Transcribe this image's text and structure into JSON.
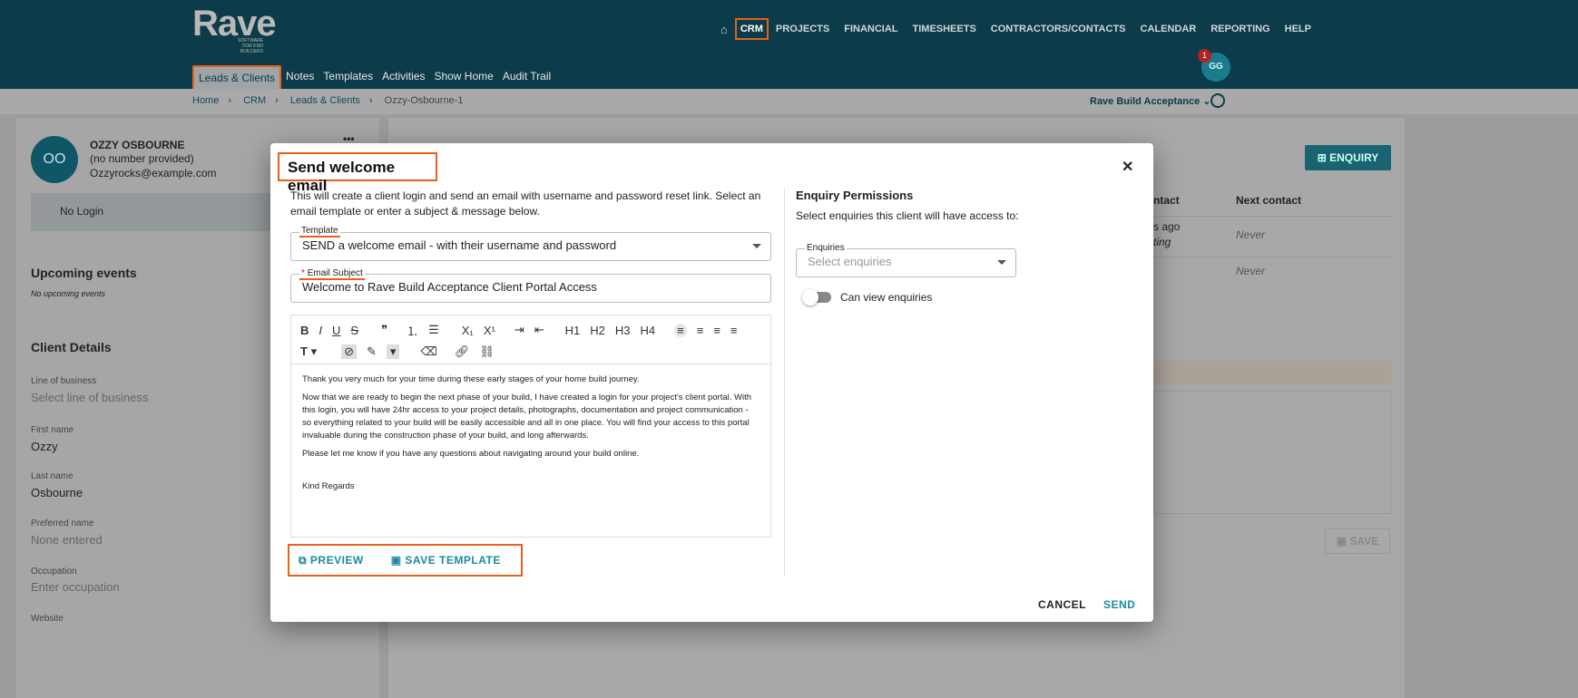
{
  "header": {
    "logo": "Rave",
    "logo_sub": "SOFTWARE FOR KIWI BUILDERS",
    "nav": [
      "CRM",
      "PROJECTS",
      "FINANCIAL",
      "TIMESHEETS",
      "CONTRACTORS/CONTACTS",
      "CALENDAR",
      "REPORTING",
      "HELP"
    ],
    "subnav": [
      "Leads & Clients",
      "Notes",
      "Templates",
      "Activities",
      "Show Home",
      "Audit Trail"
    ],
    "avatar": "GG",
    "notifications": "1"
  },
  "breadcrumb": [
    "Home",
    "CRM",
    "Leads & Clients",
    "Ozzy-Osbourne-1"
  ],
  "project_selector": "Rave Build Acceptance",
  "client": {
    "initials": "OO",
    "name": "OZZY OSBOURNE",
    "phone": "(no number provided)",
    "email": "Ozzyrocks@example.com",
    "login": "No Login",
    "upcoming_title": "Upcoming events",
    "upcoming_empty": "No upcoming events",
    "details_title": "Client Details",
    "fields": [
      {
        "label": "Line of business",
        "value": "Select line of business"
      },
      {
        "label": "First name",
        "value": "Ozzy"
      },
      {
        "label": "Last name",
        "value": "Osbourne"
      },
      {
        "label": "Preferred name",
        "value": "None entered"
      },
      {
        "label": "Occupation",
        "value": "Enter occupation"
      },
      {
        "label": "Website",
        "value": ""
      }
    ]
  },
  "right": {
    "enquiry_btn": "ENQUIRY",
    "col_contact": "ntact",
    "col_next": "Next contact",
    "row1_contact": "s ago",
    "row1_sub": "ting",
    "row1_next": "Never",
    "row2_next": "Never",
    "save_btn": "SAVE"
  },
  "modal": {
    "title": "Send welcome email",
    "description": "This will create a client login and send an email with username and password reset link. Select an email template or enter a subject & message below.",
    "template_label": "Template",
    "template_value": "SEND a welcome email - with their username and password",
    "subject_label": "Email Subject",
    "subject_required": "*",
    "subject_value": "Welcome to Rave Build Acceptance Client Portal Access",
    "body": [
      "Thank you very much for your time during these early stages of your home build journey.",
      "Now that we are ready to begin the next phase of your build, I have created a login for your project's client portal. With this login, you will have 24hr access to your project details, photographs, documentation and project communication - so everything related to your build will be easily accessible and all in one place. You will find your access to this portal invaluable during the construction phase of your build, and long afterwards.",
      "Please let me know if you have any questions about navigating around your build online.",
      "Kind Regards"
    ],
    "preview": "PREVIEW",
    "save_template": "SAVE TEMPLATE",
    "perm_title": "Enquiry Permissions",
    "perm_desc": "Select enquiries this client will have access to:",
    "enq_label": "Enquiries",
    "enq_placeholder": "Select enquiries",
    "toggle_label": "Can view enquiries",
    "toggle_on": false,
    "cancel": "CANCEL",
    "send": "SEND"
  }
}
